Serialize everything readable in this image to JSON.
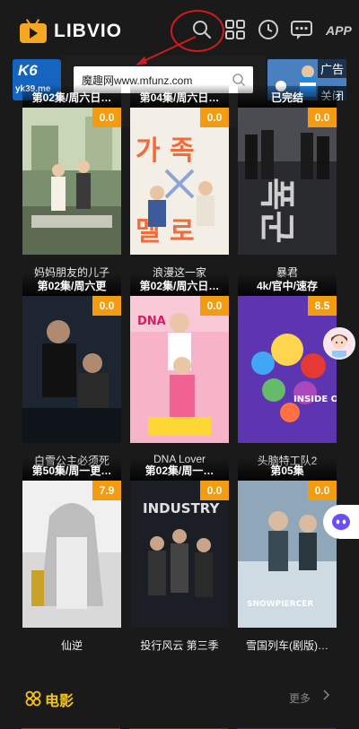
{
  "header": {
    "logo_text": "LIBVIO",
    "app_label": "APP",
    "icons": [
      "search-icon",
      "grid-icon",
      "history-clock-icon",
      "message-icon"
    ]
  },
  "banner": {
    "left_ad_brand": "K6",
    "left_ad_domain": "yk39.me",
    "ad_tag": "广告",
    "close_label": "关闭"
  },
  "search": {
    "text": "魔趣网www.mfunz.com"
  },
  "colors": {
    "accent": "#f39c12",
    "section_title": "#f5c518",
    "annotation_red": "#d01b1b"
  },
  "cards": [
    {
      "title": "妈妈朋友的儿子",
      "episode": "第02集/周六日…",
      "score": "0.0"
    },
    {
      "title": "浪漫这一家",
      "episode": "第04集/周六日…",
      "score": "0.0"
    },
    {
      "title": "暴君",
      "episode": "已完结",
      "score": "0.0"
    },
    {
      "title": "白雪公主必须死",
      "episode": "第02集/周六更",
      "score": "0.0"
    },
    {
      "title": "DNA Lover",
      "episode": "第02集/周六日…",
      "score": "0.0"
    },
    {
      "title": "头脑特工队2",
      "episode": "4k/官中/速存",
      "score": "8.5"
    },
    {
      "title": "仙逆",
      "episode": "第50集/周一更…",
      "score": "7.9"
    },
    {
      "title": "投行风云 第三季",
      "episode": "第02集/周一…",
      "score": "0.0"
    },
    {
      "title": "雪国列车(剧版)…",
      "episode": "第05集",
      "score": "0.0"
    }
  ],
  "poster_text": {
    "p2_top": "가 족",
    "p2_bottom": "멜 로",
    "p3_glyph": "폭군",
    "p5_badge": "DNA",
    "p6_badge": "INSIDE OUT 2",
    "p8_badge": "INDUSTRY",
    "p9_badge": "SNOWPIERCER"
  },
  "section": {
    "title": "电影",
    "more": "更多"
  }
}
